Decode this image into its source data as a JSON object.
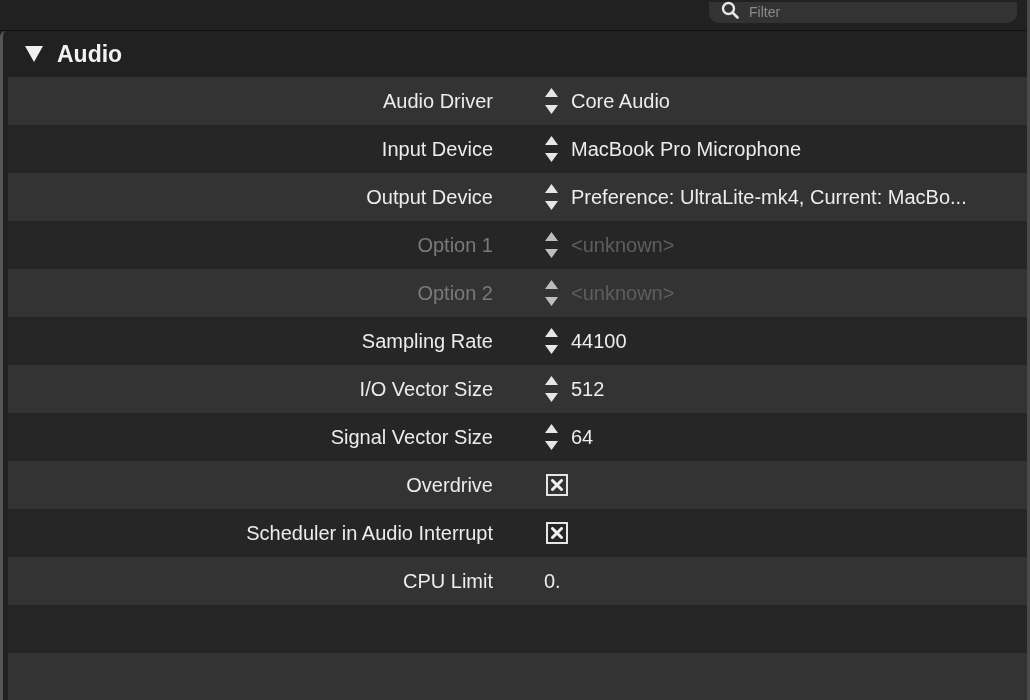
{
  "search": {
    "placeholder": "Filter"
  },
  "section": {
    "title": "Audio",
    "expanded": true
  },
  "rows": [
    {
      "label": "Audio Driver",
      "kind": "menu",
      "value": "Core Audio",
      "disabled": false
    },
    {
      "label": "Input Device",
      "kind": "menu",
      "value": "MacBook Pro Microphone",
      "disabled": false
    },
    {
      "label": "Output Device",
      "kind": "menu",
      "value": "Preference: UltraLite-mk4, Current: MacBo...",
      "disabled": false
    },
    {
      "label": "Option 1",
      "kind": "menu",
      "value": "<unknown>",
      "disabled": true
    },
    {
      "label": "Option 2",
      "kind": "menu",
      "value": "<unknown>",
      "disabled": true
    },
    {
      "label": "Sampling Rate",
      "kind": "menu",
      "value": "44100",
      "disabled": false
    },
    {
      "label": "I/O Vector Size",
      "kind": "menu",
      "value": "512",
      "disabled": false
    },
    {
      "label": "Signal Vector Size",
      "kind": "menu",
      "value": "64",
      "disabled": false
    },
    {
      "label": "Overdrive",
      "kind": "checkbox",
      "checked": true,
      "disabled": false
    },
    {
      "label": "Scheduler in Audio Interrupt",
      "kind": "checkbox",
      "checked": true,
      "disabled": false
    },
    {
      "label": "CPU Limit",
      "kind": "number",
      "value": "0.",
      "disabled": false
    }
  ]
}
